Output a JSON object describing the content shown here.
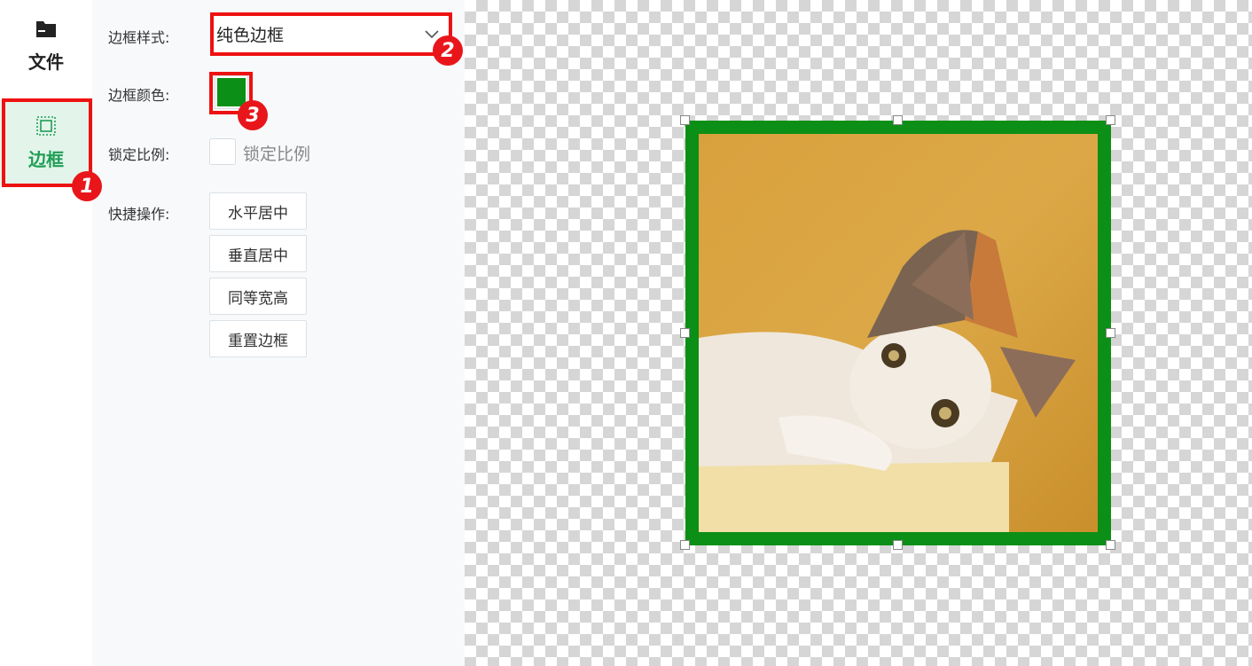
{
  "nav": {
    "file_label": "文件",
    "border_label": "边框"
  },
  "panel": {
    "border_style_label": "边框样式:",
    "border_style_value": "纯色边框",
    "border_color_label": "边框颜色:",
    "border_color_value": "#0b8f16",
    "lock_ratio_label": "锁定比例:",
    "lock_ratio_text": "锁定比例",
    "lock_ratio_checked": false,
    "quick_actions_label": "快捷操作:",
    "quick_actions": [
      "水平居中",
      "垂直居中",
      "同等宽高",
      "重置边框"
    ]
  },
  "annotations": [
    "1",
    "2",
    "3"
  ],
  "colors": {
    "accent": "#1f9e55",
    "highlight": "#ee1111",
    "frame": "#0b8f16"
  }
}
